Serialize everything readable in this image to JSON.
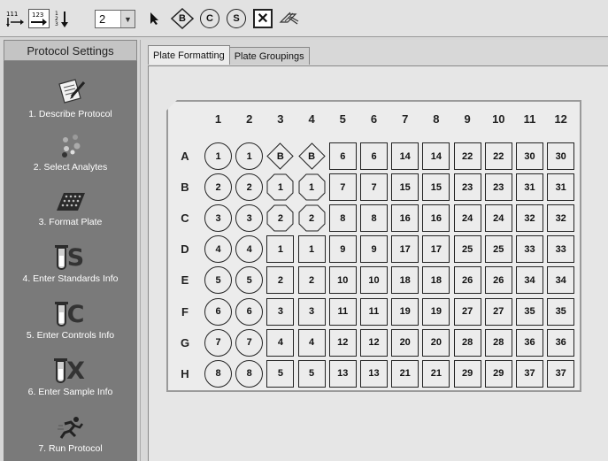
{
  "toolbar": {
    "well_count_select": "2",
    "tool_labels": {
      "blank": "B",
      "control": "C",
      "standard": "S"
    }
  },
  "sidebar": {
    "header": "Protocol Settings",
    "steps": [
      {
        "label": "1. Describe Protocol",
        "icon": "notepad-pencil-icon"
      },
      {
        "label": "2. Select Analytes",
        "icon": "beads-icon"
      },
      {
        "label": "3. Format Plate",
        "icon": "plate-icon"
      },
      {
        "label": "4. Enter Standards Info",
        "icon": "tube-s-icon",
        "letter": "S"
      },
      {
        "label": "5. Enter Controls Info",
        "icon": "tube-c-icon",
        "letter": "C"
      },
      {
        "label": "6. Enter Sample Info",
        "icon": "tube-x-icon",
        "letter": "X"
      },
      {
        "label": "7. Run Protocol",
        "icon": "runner-icon"
      }
    ]
  },
  "tabs": [
    "Plate Formatting",
    "Plate Groupings"
  ],
  "plate": {
    "columns": [
      "1",
      "2",
      "3",
      "4",
      "5",
      "6",
      "7",
      "8",
      "9",
      "10",
      "11",
      "12"
    ],
    "rows": [
      "A",
      "B",
      "C",
      "D",
      "E",
      "F",
      "G",
      "H"
    ],
    "wells": [
      [
        [
          "circle",
          "1"
        ],
        [
          "circle",
          "1"
        ],
        [
          "diamond",
          "B"
        ],
        [
          "diamond",
          "B"
        ],
        [
          "square",
          "6"
        ],
        [
          "square",
          "6"
        ],
        [
          "square",
          "14"
        ],
        [
          "square",
          "14"
        ],
        [
          "square",
          "22"
        ],
        [
          "square",
          "22"
        ],
        [
          "square",
          "30"
        ],
        [
          "square",
          "30"
        ]
      ],
      [
        [
          "circle",
          "2"
        ],
        [
          "circle",
          "2"
        ],
        [
          "octagon",
          "1"
        ],
        [
          "octagon",
          "1"
        ],
        [
          "square",
          "7"
        ],
        [
          "square",
          "7"
        ],
        [
          "square",
          "15"
        ],
        [
          "square",
          "15"
        ],
        [
          "square",
          "23"
        ],
        [
          "square",
          "23"
        ],
        [
          "square",
          "31"
        ],
        [
          "square",
          "31"
        ]
      ],
      [
        [
          "circle",
          "3"
        ],
        [
          "circle",
          "3"
        ],
        [
          "octagon",
          "2"
        ],
        [
          "octagon",
          "2"
        ],
        [
          "square",
          "8"
        ],
        [
          "square",
          "8"
        ],
        [
          "square",
          "16"
        ],
        [
          "square",
          "16"
        ],
        [
          "square",
          "24"
        ],
        [
          "square",
          "24"
        ],
        [
          "square",
          "32"
        ],
        [
          "square",
          "32"
        ]
      ],
      [
        [
          "circle",
          "4"
        ],
        [
          "circle",
          "4"
        ],
        [
          "square",
          "1"
        ],
        [
          "square",
          "1"
        ],
        [
          "square",
          "9"
        ],
        [
          "square",
          "9"
        ],
        [
          "square",
          "17"
        ],
        [
          "square",
          "17"
        ],
        [
          "square",
          "25"
        ],
        [
          "square",
          "25"
        ],
        [
          "square",
          "33"
        ],
        [
          "square",
          "33"
        ]
      ],
      [
        [
          "circle",
          "5"
        ],
        [
          "circle",
          "5"
        ],
        [
          "square",
          "2"
        ],
        [
          "square",
          "2"
        ],
        [
          "square",
          "10"
        ],
        [
          "square",
          "10"
        ],
        [
          "square",
          "18"
        ],
        [
          "square",
          "18"
        ],
        [
          "square",
          "26"
        ],
        [
          "square",
          "26"
        ],
        [
          "square",
          "34"
        ],
        [
          "square",
          "34"
        ]
      ],
      [
        [
          "circle",
          "6"
        ],
        [
          "circle",
          "6"
        ],
        [
          "square",
          "3"
        ],
        [
          "square",
          "3"
        ],
        [
          "square",
          "11"
        ],
        [
          "square",
          "11"
        ],
        [
          "square",
          "19"
        ],
        [
          "square",
          "19"
        ],
        [
          "square",
          "27"
        ],
        [
          "square",
          "27"
        ],
        [
          "square",
          "35"
        ],
        [
          "square",
          "35"
        ]
      ],
      [
        [
          "circle",
          "7"
        ],
        [
          "circle",
          "7"
        ],
        [
          "square",
          "4"
        ],
        [
          "square",
          "4"
        ],
        [
          "square",
          "12"
        ],
        [
          "square",
          "12"
        ],
        [
          "square",
          "20"
        ],
        [
          "square",
          "20"
        ],
        [
          "square",
          "28"
        ],
        [
          "square",
          "28"
        ],
        [
          "square",
          "36"
        ],
        [
          "square",
          "36"
        ]
      ],
      [
        [
          "circle",
          "8"
        ],
        [
          "circle",
          "8"
        ],
        [
          "square",
          "5"
        ],
        [
          "square",
          "5"
        ],
        [
          "square",
          "13"
        ],
        [
          "square",
          "13"
        ],
        [
          "square",
          "21"
        ],
        [
          "square",
          "21"
        ],
        [
          "square",
          "29"
        ],
        [
          "square",
          "29"
        ],
        [
          "square",
          "37"
        ],
        [
          "square",
          "37"
        ]
      ]
    ]
  }
}
